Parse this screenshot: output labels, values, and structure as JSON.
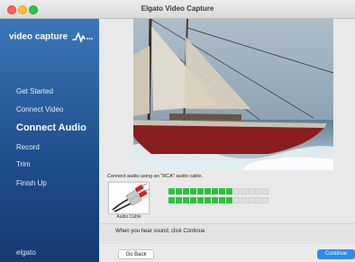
{
  "window": {
    "title": "Elgato Video Capture"
  },
  "sidebar": {
    "logo_text": "video capture",
    "items": [
      {
        "label": "Get Started"
      },
      {
        "label": "Connect Video"
      },
      {
        "label": "Connect Audio",
        "active": true
      },
      {
        "label": "Record"
      },
      {
        "label": "Trim"
      },
      {
        "label": "Finish Up"
      }
    ],
    "brand": "elgato"
  },
  "main": {
    "instruction": "Connect audio using an \"RCA\" audio cable.",
    "cable_label": "Audio Cable",
    "audio_meter": {
      "segments": 14,
      "left_channel_lit": 9,
      "right_channel_lit": 9
    },
    "hint": "When you hear sound, click Continue."
  },
  "buttons": {
    "back": "Go Back",
    "continue": "Continue"
  },
  "colors": {
    "sidebar_top": "#3c77b8",
    "sidebar_bottom": "#153b73",
    "meter_on": "#2bc23b",
    "continue_button": "#2d8cf0"
  }
}
